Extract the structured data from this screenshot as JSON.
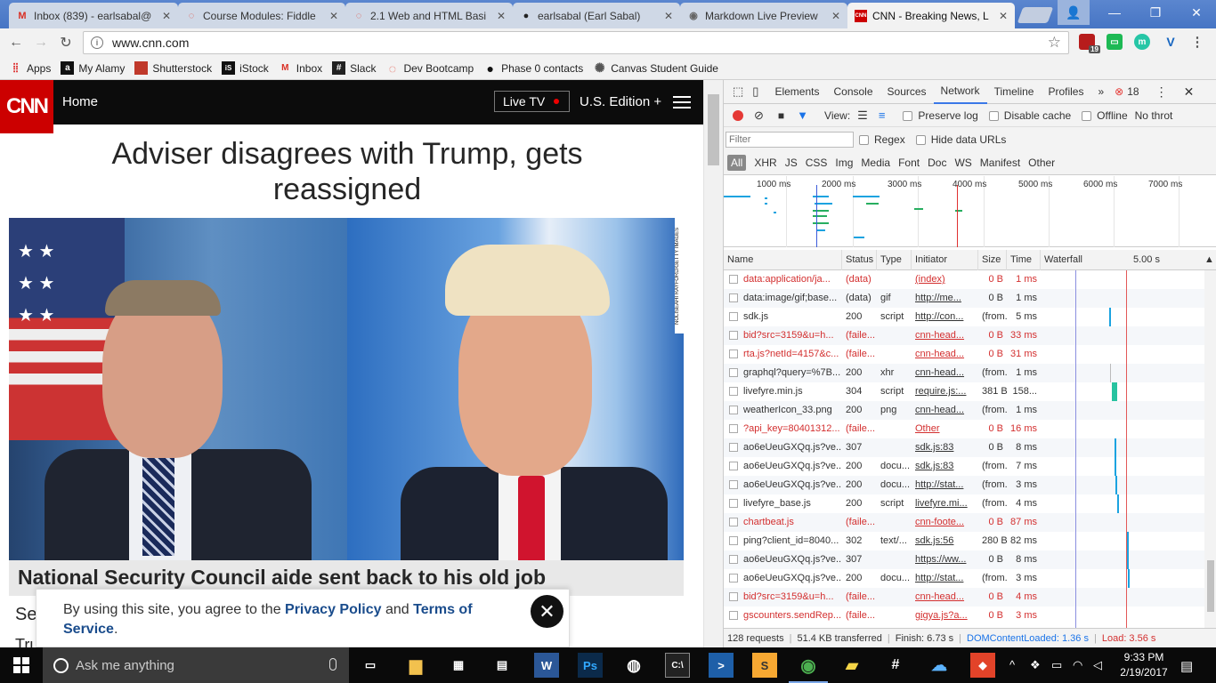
{
  "browser": {
    "tabs": [
      {
        "title": "Inbox (839) - earlsabal@",
        "icon": "gmail-icon"
      },
      {
        "title": "Course Modules: Fiddle",
        "icon": "canvas-icon"
      },
      {
        "title": "2.1 Web and HTML Basi",
        "icon": "canvas-icon"
      },
      {
        "title": "earlsabal (Earl Sabal)",
        "icon": "github-icon"
      },
      {
        "title": "Markdown Live Preview",
        "icon": "markdown-icon"
      },
      {
        "title": "CNN - Breaking News, L",
        "icon": "cnn-icon"
      }
    ],
    "url": "www.cnn.com",
    "extension_badge": "19",
    "bookmarks": [
      {
        "label": "Apps",
        "icon": "apps-grid-icon"
      },
      {
        "label": "My Alamy",
        "icon": "alamy-icon"
      },
      {
        "label": "Shutterstock",
        "icon": "shutterstock-icon"
      },
      {
        "label": "iStock",
        "icon": "istock-icon"
      },
      {
        "label": "Inbox",
        "icon": "gmail-icon"
      },
      {
        "label": "Slack",
        "icon": "slack-icon"
      },
      {
        "label": "Dev Bootcamp",
        "icon": "canvas-icon"
      },
      {
        "label": "Phase 0 contacts",
        "icon": "github-icon"
      },
      {
        "label": "Canvas Student Guide",
        "icon": "canvas-icon"
      }
    ]
  },
  "cnn": {
    "logo": "CNN",
    "home": "Home",
    "live_tv": "Live TV",
    "edition": "U.S. Edition +",
    "headline": "Adviser disagrees with Trump, gets reassigned",
    "photo_credit": "NOLISEAHI RAYFORD/GETTY IMAGES",
    "caption": "National Security Council aide sent back to his old job",
    "section_fragment": "Se",
    "trump_fragment": "Tru",
    "cookie": {
      "text_before": "By using this site, you agree to the ",
      "privacy": "Privacy Policy",
      "and": " and ",
      "terms": "Terms of Service",
      "end": "."
    }
  },
  "devtools": {
    "tabs": [
      "Elements",
      "Console",
      "Sources",
      "Network",
      "Timeline",
      "Profiles",
      "»"
    ],
    "selected_tab": "Network",
    "error_count": "18",
    "view_label": "View:",
    "preserve_log": "Preserve log",
    "disable_cache": "Disable cache",
    "offline": "Offline",
    "throttle": "No throt",
    "filter_placeholder": "Filter",
    "regex": "Regex",
    "hide_data_urls": "Hide data URLs",
    "types": [
      "All",
      "XHR",
      "JS",
      "CSS",
      "Img",
      "Media",
      "Font",
      "Doc",
      "WS",
      "Manifest",
      "Other"
    ],
    "timeline_ticks": [
      "1000 ms",
      "2000 ms",
      "3000 ms",
      "4000 ms",
      "5000 ms",
      "6000 ms",
      "7000 ms"
    ],
    "columns": {
      "name": "Name",
      "status": "Status",
      "type": "Type",
      "initiator": "Initiator",
      "size": "Size",
      "time": "Time",
      "waterfall": "Waterfall",
      "waterfall_scale": "5.00 s"
    },
    "rows": [
      {
        "name": "data:application/ja...",
        "status": "(data)",
        "type": "",
        "initiator": "(index)",
        "size": "0 B",
        "time": "1 ms",
        "err": true
      },
      {
        "name": "data:image/gif;base...",
        "status": "(data)",
        "type": "gif",
        "initiator": "http://me...",
        "size": "0 B",
        "time": "1 ms",
        "err": false
      },
      {
        "name": "sdk.js",
        "status": "200",
        "type": "script",
        "initiator": "http://con...",
        "size": "(from...",
        "time": "5 ms",
        "err": false
      },
      {
        "name": "bid?src=3159&u=h...",
        "status": "(faile...",
        "type": "",
        "initiator": "cnn-head...",
        "size": "0 B",
        "time": "33 ms",
        "err": true
      },
      {
        "name": "rta.js?netId=4157&c...",
        "status": "(faile...",
        "type": "",
        "initiator": "cnn-head...",
        "size": "0 B",
        "time": "31 ms",
        "err": true
      },
      {
        "name": "graphql?query=%7B...",
        "status": "200",
        "type": "xhr",
        "initiator": "cnn-head...",
        "size": "(from...",
        "time": "1 ms",
        "err": false
      },
      {
        "name": "livefyre.min.js",
        "status": "304",
        "type": "script",
        "initiator": "require.js:...",
        "size": "381 B",
        "time": "158...",
        "err": false
      },
      {
        "name": "weatherIcon_33.png",
        "status": "200",
        "type": "png",
        "initiator": "cnn-head...",
        "size": "(from...",
        "time": "1 ms",
        "err": false
      },
      {
        "name": "?api_key=80401312...",
        "status": "(faile...",
        "type": "",
        "initiator": "Other",
        "size": "0 B",
        "time": "16 ms",
        "err": true
      },
      {
        "name": "ao6eUeuGXQq.js?ve...",
        "status": "307",
        "type": "",
        "initiator": "sdk.js:83",
        "size": "0 B",
        "time": "8 ms",
        "err": false
      },
      {
        "name": "ao6eUeuGXQq.js?ve...",
        "status": "200",
        "type": "docu...",
        "initiator": "sdk.js:83",
        "size": "(from...",
        "time": "7 ms",
        "err": false
      },
      {
        "name": "ao6eUeuGXQq.js?ve...",
        "status": "200",
        "type": "docu...",
        "initiator": "http://stat...",
        "size": "(from...",
        "time": "3 ms",
        "err": false
      },
      {
        "name": "livefyre_base.js",
        "status": "200",
        "type": "script",
        "initiator": "livefyre.mi...",
        "size": "(from...",
        "time": "4 ms",
        "err": false
      },
      {
        "name": "chartbeat.js",
        "status": "(faile...",
        "type": "",
        "initiator": "cnn-foote...",
        "size": "0 B",
        "time": "87 ms",
        "err": true
      },
      {
        "name": "ping?client_id=8040...",
        "status": "302",
        "type": "text/...",
        "initiator": "sdk.js:56",
        "size": "280 B",
        "time": "82 ms",
        "err": false
      },
      {
        "name": "ao6eUeuGXQq.js?ve...",
        "status": "307",
        "type": "",
        "initiator": "https://ww...",
        "size": "0 B",
        "time": "8 ms",
        "err": false
      },
      {
        "name": "ao6eUeuGXQq.js?ve...",
        "status": "200",
        "type": "docu...",
        "initiator": "http://stat...",
        "size": "(from...",
        "time": "3 ms",
        "err": false
      },
      {
        "name": "bid?src=3159&u=h...",
        "status": "(faile...",
        "type": "",
        "initiator": "cnn-head...",
        "size": "0 B",
        "time": "4 ms",
        "err": true
      },
      {
        "name": "gscounters.sendRep...",
        "status": "(faile...",
        "type": "",
        "initiator": "gigya.js?a...",
        "size": "0 B",
        "time": "3 ms",
        "err": true
      }
    ],
    "status_bar": {
      "requests": "128 requests",
      "transferred": "51.4 KB transferred",
      "finish": "Finish: 6.73 s",
      "dom": "DOMContentLoaded: 1.36 s",
      "load": "Load: 3.56 s"
    },
    "colors": {
      "dom_line": "#3b5bdb",
      "load_line": "#e03131"
    }
  },
  "taskbar": {
    "search_placeholder": "Ask me anything",
    "time": "9:33 PM",
    "date": "2/19/2017"
  }
}
